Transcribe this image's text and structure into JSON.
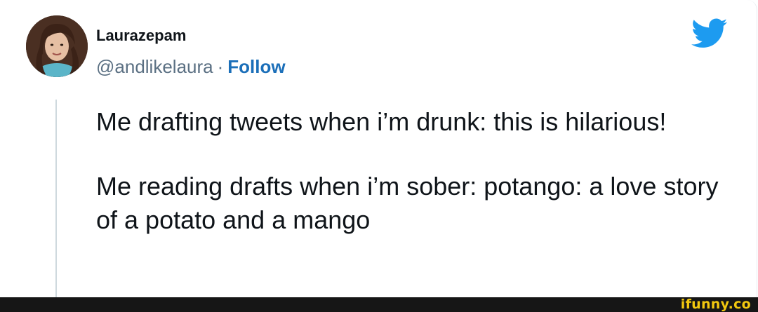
{
  "tweet": {
    "display_name": "Laurazepam",
    "handle": "@andlikelaura",
    "separator": "·",
    "follow_label": "Follow",
    "paragraphs": [
      "Me drafting tweets when i’m drunk: this is hilarious!",
      "Me reading drafts when i’m sober: potango: a love story of a potato and a mango"
    ]
  },
  "icons": {
    "brand": "twitter-bird-icon",
    "avatar": "profile-avatar"
  },
  "colors": {
    "twitter_blue": "#1d9bf0",
    "follow_link": "#1b6fb9",
    "secondary_text": "#5b7083",
    "watermark": "#f2c80f"
  },
  "watermark": {
    "text": "ifunny.co"
  }
}
